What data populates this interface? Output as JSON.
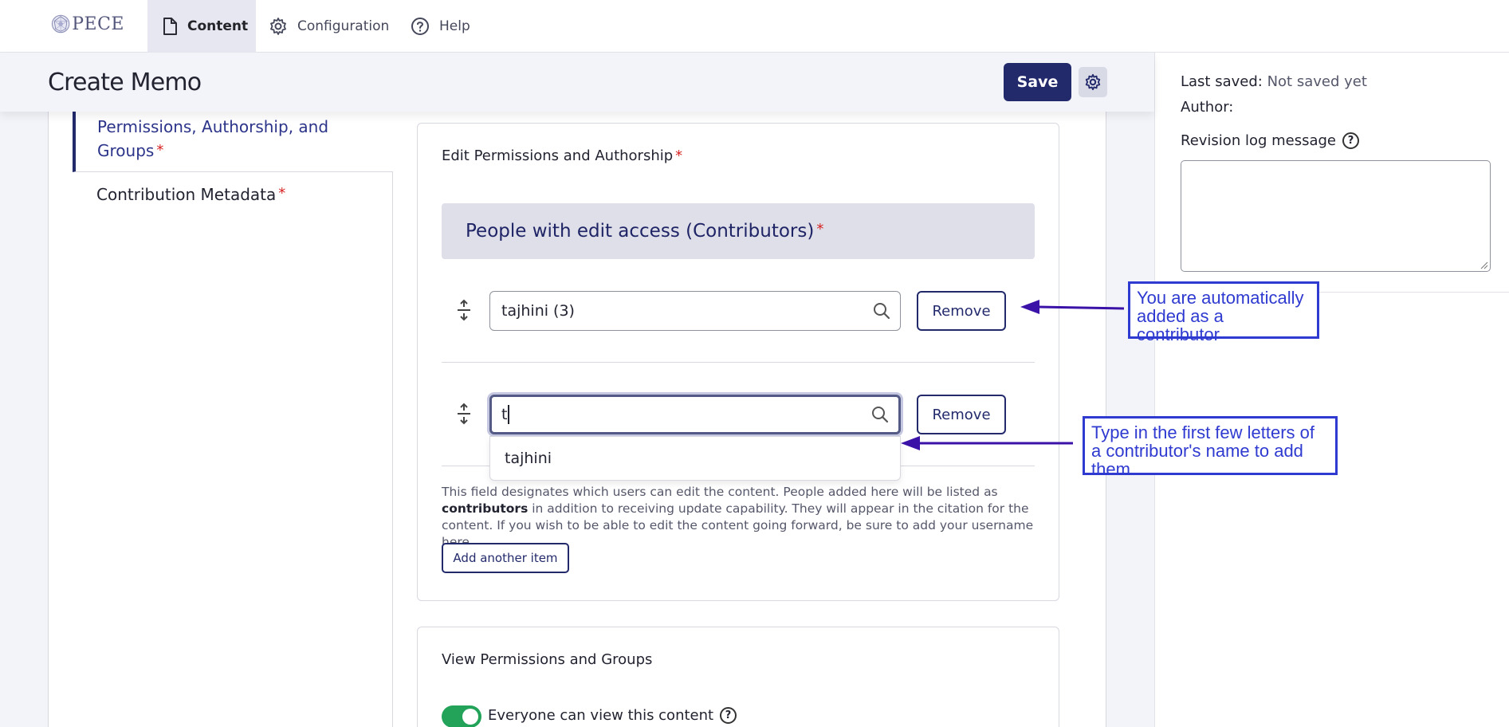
{
  "nav": {
    "logo_text": "PECE",
    "tabs": [
      {
        "label": "Content",
        "icon": "document-icon",
        "active": true
      },
      {
        "label": "Configuration",
        "icon": "gear-icon",
        "active": false
      },
      {
        "label": "Help",
        "icon": "help-circle-icon",
        "active": false
      }
    ]
  },
  "page": {
    "title": "Create Memo",
    "save_label": "Save"
  },
  "vertical_tabs": {
    "active_label": "Permissions, Authorship, and Groups",
    "other_label": "Contribution Metadata",
    "required_mark": "*"
  },
  "edit_permissions": {
    "legend": "Edit Permissions and Authorship",
    "table_header": "People with edit access (Contributors)",
    "rows": [
      {
        "value": "tajhini (3)",
        "remove_label": "Remove"
      },
      {
        "value": "t",
        "remove_label": "Remove"
      }
    ],
    "autocomplete_suggestion": "tajhini",
    "description_part1": "This field designates which users can edit the content. People added here will be listed as ",
    "description_bold": "contributors",
    "description_part2": " in addition to receiving update capability. They will appear in the citation for the content. If you wish to be able to edit the content going forward, be sure to add your username here.",
    "add_another_label": "Add another item"
  },
  "view_permissions": {
    "legend": "View Permissions and Groups",
    "toggle_label": "Everyone can view this content",
    "toggle_on": true
  },
  "sidebar": {
    "last_saved_label": "Last saved:",
    "last_saved_value": "Not saved yet",
    "author_label": "Author:",
    "revision_label": "Revision log message"
  },
  "annotations": {
    "note1": "You are automatically added as a contributor",
    "note2": "Type in the first few letters of a contributor's name to add them",
    "color": "#2f3ad0"
  },
  "colors": {
    "primary": "#232a6c",
    "required": "#d72222",
    "toggle_on": "#23a35a"
  }
}
